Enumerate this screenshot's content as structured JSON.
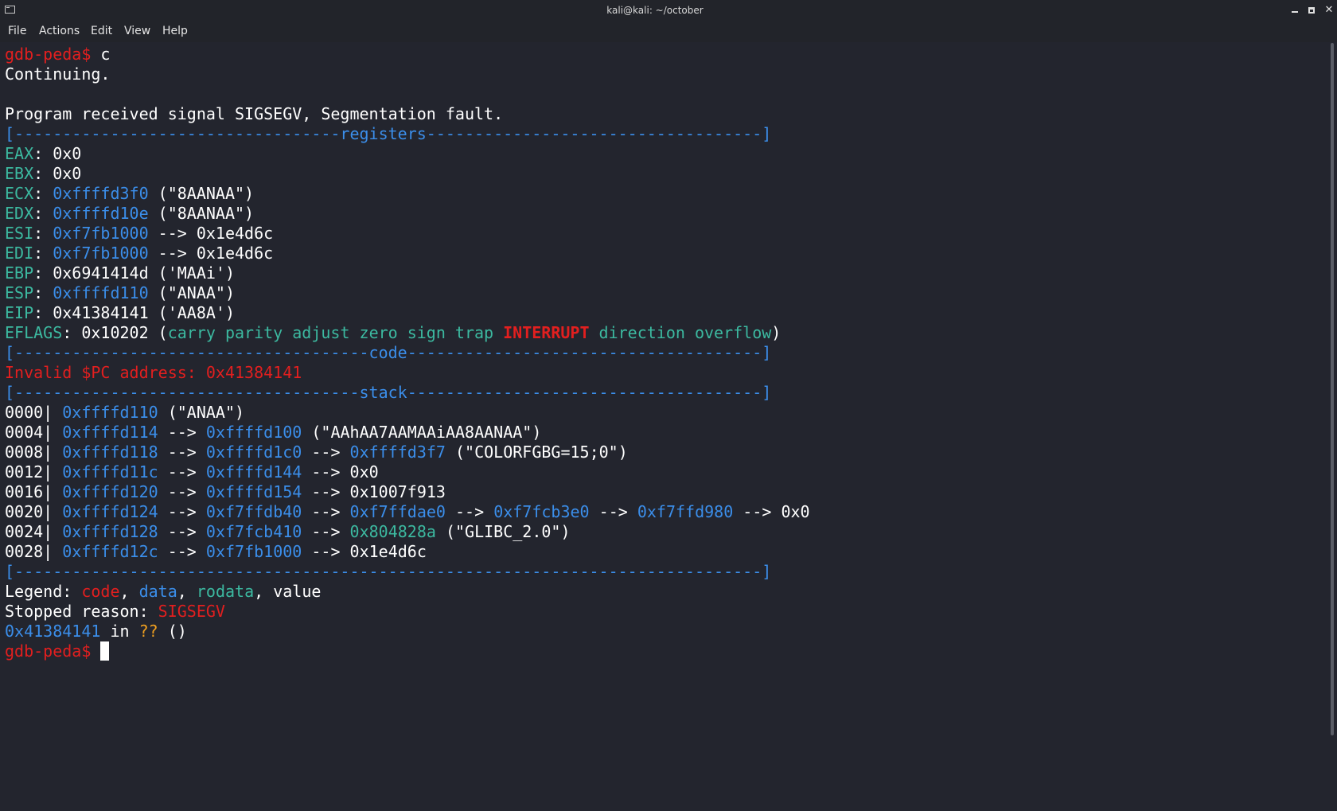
{
  "window": {
    "title": "kali@kali: ~/october",
    "controls": {
      "minimize": "minimize",
      "maximize": "maximize",
      "close": "✕"
    }
  },
  "menu": {
    "file": "File",
    "actions": "Actions",
    "edit": "Edit",
    "view": "View",
    "help": "Help"
  },
  "terminal": {
    "prompt": "gdb-peda$",
    "command": " c",
    "continuing": "Continuing.",
    "signal_line": "Program received signal SIGSEGV, Segmentation fault.",
    "sep_registers": "[----------------------------------registers-----------------------------------]",
    "registers": {
      "eax": {
        "name": "EAX",
        "rest": ": 0x0"
      },
      "ebx": {
        "name": "EBX",
        "rest": ": 0x0"
      },
      "ecx": {
        "name": "ECX",
        "sep": ": ",
        "addr": "0xffffd3f0",
        "rest": " (\"8AANAA\")"
      },
      "edx": {
        "name": "EDX",
        "sep": ": ",
        "addr": "0xffffd10e",
        "rest": " (\"8AANAA\")"
      },
      "esi": {
        "name": "ESI",
        "sep": ": ",
        "addr": "0xf7fb1000",
        "rest": " --> 0x1e4d6c"
      },
      "edi": {
        "name": "EDI",
        "sep": ": ",
        "addr": "0xf7fb1000",
        "rest": " --> 0x1e4d6c"
      },
      "ebp": {
        "name": "EBP",
        "rest": ": 0x6941414d ('MAAi')"
      },
      "esp": {
        "name": "ESP",
        "sep": ": ",
        "addr": "0xffffd110",
        "rest": " (\"ANAA\")"
      },
      "eip": {
        "name": "EIP",
        "rest": ": 0x41384141 ('AA8A')"
      },
      "eflags": {
        "name": "EFLAGS",
        "value": ": 0x10202 (",
        "flags_pre": "carry parity adjust zero sign trap ",
        "flag_set": "INTERRUPT",
        "flags_post": " direction overflow",
        "close": ")"
      }
    },
    "sep_code": "[-------------------------------------code-------------------------------------]",
    "invalid_pc": "Invalid $PC address: 0x41384141",
    "sep_stack": "[------------------------------------stack-------------------------------------]",
    "stack": [
      {
        "off": "0000|",
        "a1": "0xffffd110",
        "tail": " (\"ANAA\")"
      },
      {
        "off": "0004|",
        "a1": "0xffffd114",
        "arr1": " --> ",
        "a2": "0xffffd100",
        "tail": " (\"AAhAA7AAMAAiAA8AANAA\")"
      },
      {
        "off": "0008|",
        "a1": "0xffffd118",
        "arr1": " --> ",
        "a2": "0xffffd1c0",
        "arr2": " --> ",
        "a3": "0xffffd3f7",
        "tail": " (\"COLORFGBG=15;0\")"
      },
      {
        "off": "0012|",
        "a1": "0xffffd11c",
        "arr1": " --> ",
        "a2": "0xffffd144",
        "tail": " --> 0x0"
      },
      {
        "off": "0016|",
        "a1": "0xffffd120",
        "arr1": " --> ",
        "a2": "0xffffd154",
        "tail": " --> 0x1007f913"
      },
      {
        "off": "0020|",
        "a1": "0xffffd124",
        "arr1": " --> ",
        "a2": "0xf7ffdb40",
        "arr2": " --> ",
        "a3": "0xf7ffdae0",
        "arr3": " --> ",
        "a4": "0xf7fcb3e0",
        "arr4": " --> ",
        "a5": "0xf7ffd980",
        "tail": " --> 0x0"
      },
      {
        "off": "0024|",
        "a1": "0xffffd128",
        "arr1": " --> ",
        "a2": "0xf7fcb410",
        "arr2": " --> ",
        "a3": "0x804828a",
        "tail": " (\"GLIBC_2.0\")"
      },
      {
        "off": "0028|",
        "a1": "0xffffd12c",
        "arr1": " --> ",
        "a2": "0xf7fb1000",
        "tail": " --> 0x1e4d6c"
      }
    ],
    "sep_end": "[------------------------------------------------------------------------------]",
    "legend": {
      "label": "Legend: ",
      "code": "code",
      "comma1": ", ",
      "data": "data",
      "comma2": ", ",
      "rodata": "rodata",
      "comma3": ", ",
      "value": "value"
    },
    "stopped": {
      "label": "Stopped reason: ",
      "reason": "SIGSEGV"
    },
    "location": {
      "addr": "0x41384141",
      "in": " in ",
      "func": "??",
      "args": " ()"
    },
    "final_prompt": "gdb-peda$",
    "final_space": " "
  }
}
